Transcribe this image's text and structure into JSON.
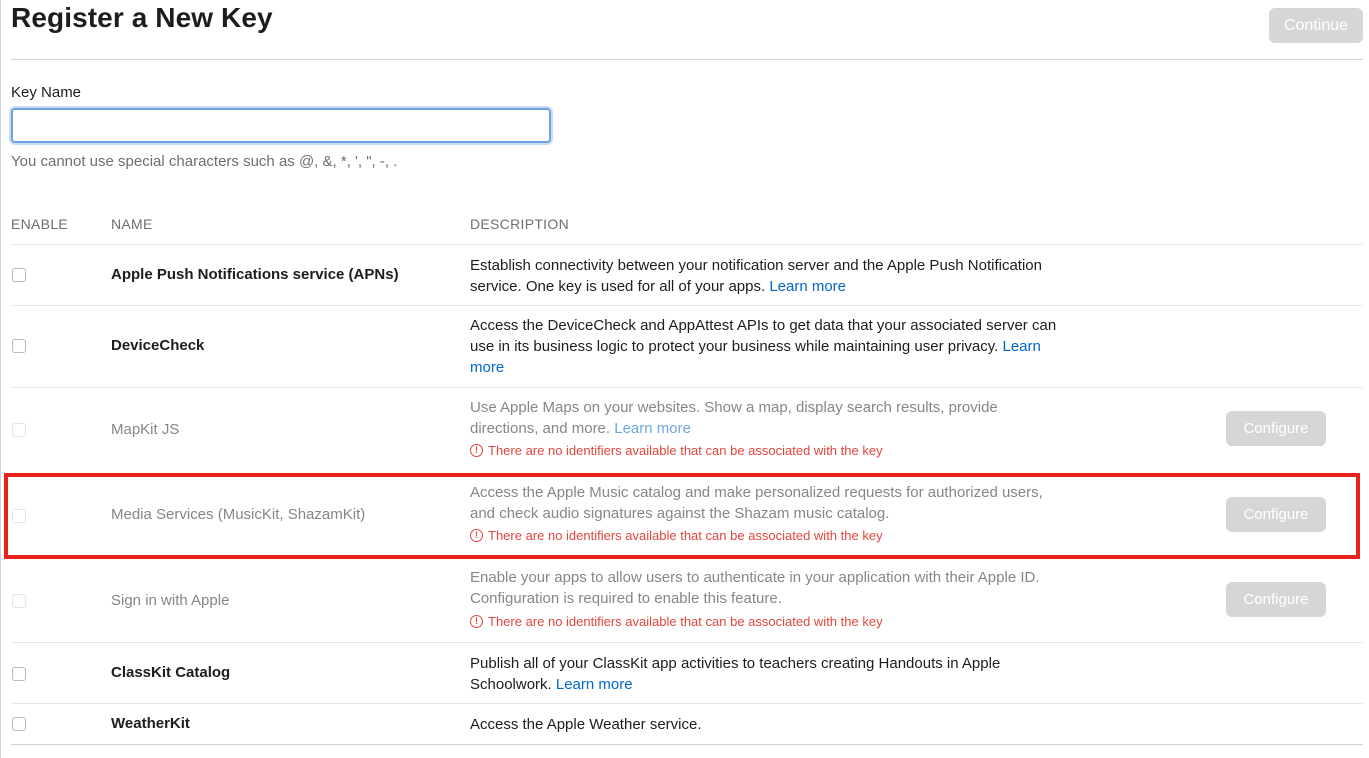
{
  "page": {
    "title": "Register a New Key",
    "continue_label": "Continue"
  },
  "key_name": {
    "label": "Key Name",
    "value": "",
    "placeholder": "",
    "help": "You cannot use special characters such as @, &, *, ', \", -, ."
  },
  "table": {
    "headers": {
      "enable": "ENABLE",
      "name": "NAME",
      "description": "DESCRIPTION"
    },
    "learn_more": "Learn more",
    "warning": "There are no identifiers available that can be associated with the key",
    "configure_label": "Configure",
    "rows": [
      {
        "name": "Apple Push Notifications service (APNs)",
        "description": "Establish connectivity between your notification server and the Apple Push Notification service. One key is used for all of your apps.",
        "enabled": false,
        "disabled": false
      },
      {
        "name": "DeviceCheck",
        "description": "Access the DeviceCheck and AppAttest APIs to get data that your associated server can use in its business logic to protect your business while maintaining user privacy.",
        "enabled": false,
        "disabled": false
      },
      {
        "name": "MapKit JS",
        "description": "Use Apple Maps on your websites. Show a map, display search results, provide directions, and more.",
        "enabled": false,
        "disabled": true
      },
      {
        "name": "Media Services (MusicKit, ShazamKit)",
        "description": "Access the Apple Music catalog and make personalized requests for authorized users, and check audio signatures against the Shazam music catalog.",
        "enabled": false,
        "disabled": true
      },
      {
        "name": "Sign in with Apple",
        "description": "Enable your apps to allow users to authenticate in your application with their Apple ID. Configuration is required to enable this feature.",
        "enabled": false,
        "disabled": true
      },
      {
        "name": "ClassKit Catalog",
        "description": "Publish all of your ClassKit app activities to teachers creating Handouts in Apple Schoolwork.",
        "enabled": false,
        "disabled": false
      },
      {
        "name": "WeatherKit",
        "description": "Access the Apple Weather service.",
        "enabled": false,
        "disabled": false
      }
    ]
  },
  "colors": {
    "link": "#0066cc",
    "warning": "#e0463e",
    "highlight_border": "#e8221c",
    "disabled_button": "#d6d6d6"
  },
  "icons": {
    "warning": "exclamation-circle-icon",
    "checkbox": "checkbox-icon"
  }
}
